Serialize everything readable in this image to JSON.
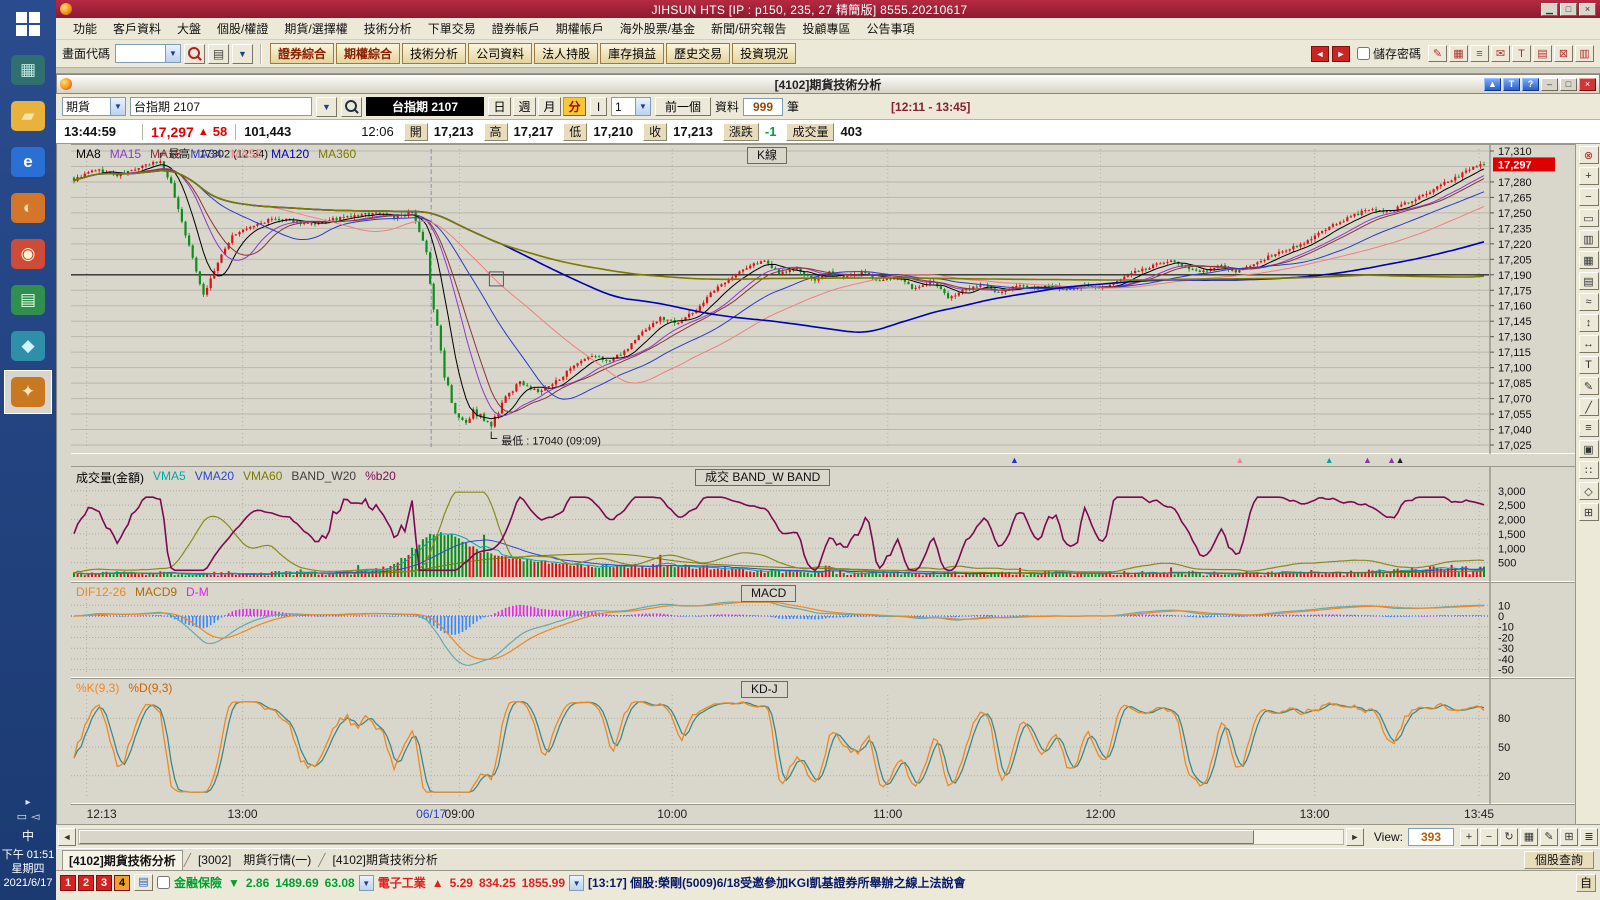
{
  "titlebar": {
    "title": "JIHSUN HTS    [IP : p150, 235, 27 精簡版] 8555.20210617"
  },
  "sidebar": {
    "clock_ampm": "下午 01:51",
    "clock_weekday": "星期四",
    "clock_date": "2021/6/17",
    "lang_indicator": "中",
    "icons": [
      {
        "name": "start-menu",
        "glyph": "",
        "bg": "",
        "fg": ""
      },
      {
        "name": "spreadsheet-app",
        "glyph": "▦",
        "bg": "#2f6f6f",
        "fg": "#bfe8e0"
      },
      {
        "name": "folder",
        "glyph": "▰",
        "bg": "#e8b23c",
        "fg": "#f8e4a8"
      },
      {
        "name": "internet-explorer",
        "glyph": "e",
        "bg": "#2a6fd4",
        "fg": "#ffffff"
      },
      {
        "name": "paint-app",
        "glyph": "◐",
        "bg": "#d4762a",
        "fg": "#ffe2b0"
      },
      {
        "name": "chrome-browser",
        "glyph": "◉",
        "bg": "#ce4b37",
        "fg": "#fdf3d0"
      },
      {
        "name": "document-app",
        "glyph": "▤",
        "bg": "#2f8f4f",
        "fg": "#e0ffe0"
      },
      {
        "name": "cad-app",
        "glyph": "◆",
        "bg": "#2f8fa8",
        "fg": "#d0f4ff"
      },
      {
        "name": "hts-app",
        "glyph": "✦",
        "bg": "#c87820",
        "fg": "#ffe8c0",
        "active": true
      }
    ]
  },
  "menus": [
    "功能",
    "客戶資料",
    "大盤",
    "個股/權證",
    "期貨/選擇權",
    "技術分析",
    "下單交易",
    "證券帳戶",
    "期權帳戶",
    "海外股票/基金",
    "新聞/研究報告",
    "投顧專區",
    "公告事項"
  ],
  "toolbar": {
    "screen_code_label": "畫面代碼",
    "quick_buttons": [
      {
        "label": "證券綜合",
        "accent": true
      },
      {
        "label": "期權綜合",
        "accent": true
      },
      {
        "label": "技術分析",
        "accent": false
      },
      {
        "label": "公司資料",
        "accent": false
      },
      {
        "label": "法人持股",
        "accent": false
      },
      {
        "label": "庫存損益",
        "accent": false
      },
      {
        "label": "歷史交易",
        "accent": false
      },
      {
        "label": "投資現況",
        "accent": false
      }
    ],
    "save_password_label": "儲存密碼",
    "right_icons": [
      "✎",
      "▦",
      "≡",
      "✉",
      "T",
      "▤",
      "⊠",
      "▥"
    ]
  },
  "window": {
    "title": "[4102]期貨技術分析",
    "btn_up": "▲",
    "btn_t": "T",
    "btn_help": "?",
    "btn_min": "–",
    "btn_max": "□",
    "btn_close": "×"
  },
  "controls": {
    "market": "期貨",
    "symbol": "台指期 2107",
    "symbol_display": "台指期 2107",
    "periods": [
      "日",
      "週",
      "月",
      "分"
    ],
    "active_period": "分",
    "i_button": "I",
    "interval": "1",
    "prev_button": "前一個",
    "data_label": "資料",
    "data_count": "999",
    "unit_label": "筆",
    "range_label": "[12:11 - 13:45]"
  },
  "quote": {
    "time": "13:44:59",
    "last": "17,297",
    "dir": "▲",
    "change": "58",
    "total_volume": "101,443",
    "bar_time": "12:06",
    "open_label": "開",
    "open": "17,213",
    "high_label": "高",
    "high": "17,217",
    "low_label": "低",
    "low": "17,210",
    "close_label": "收",
    "close": "17,213",
    "chg_label": "漲跌",
    "chg": "-1",
    "vol_label": "成交量",
    "vol": "403"
  },
  "chart_data": {
    "type": "candlestick",
    "symbol": "台指期 2107",
    "interval": "1分",
    "bars": 393,
    "price_axis": {
      "min": 17025,
      "max": 17310,
      "tick_step": 15
    },
    "current_price": 17297,
    "prev_ref_price": 17190,
    "session_break_frac": 0.254,
    "high_annotation": {
      "text": "最高 : 17302 (12:34)",
      "price": 17302,
      "frac": 0.06
    },
    "low_annotation": {
      "text": "最低 : 17040 (09:09)",
      "price": 17040,
      "frac": 0.296
    },
    "cursor_box": {
      "frac": 0.3,
      "price": 17186
    },
    "x_labels": [
      {
        "label": "12:13",
        "frac": 0.011
      },
      {
        "label": "13:00",
        "frac": 0.121
      },
      {
        "label": "06/17",
        "frac": 0.254,
        "highlight": true
      },
      {
        "label": "09:00",
        "frac": 0.274
      },
      {
        "label": "10:00",
        "frac": 0.424
      },
      {
        "label": "11:00",
        "frac": 0.576
      },
      {
        "label": "12:00",
        "frac": 0.726
      },
      {
        "label": "13:00",
        "frac": 0.877
      },
      {
        "label": "13:45",
        "frac": 0.993
      }
    ],
    "price_anchors": [
      [
        0.0,
        17282
      ],
      [
        0.015,
        17292
      ],
      [
        0.03,
        17286
      ],
      [
        0.045,
        17293
      ],
      [
        0.06,
        17300
      ],
      [
        0.068,
        17282
      ],
      [
        0.08,
        17225
      ],
      [
        0.092,
        17170
      ],
      [
        0.1,
        17196
      ],
      [
        0.112,
        17228
      ],
      [
        0.125,
        17236
      ],
      [
        0.14,
        17244
      ],
      [
        0.155,
        17242
      ],
      [
        0.17,
        17238
      ],
      [
        0.185,
        17244
      ],
      [
        0.2,
        17247
      ],
      [
        0.215,
        17250
      ],
      [
        0.23,
        17246
      ],
      [
        0.242,
        17248
      ],
      [
        0.25,
        17210
      ],
      [
        0.256,
        17150
      ],
      [
        0.262,
        17100
      ],
      [
        0.27,
        17060
      ],
      [
        0.278,
        17050
      ],
      [
        0.285,
        17058
      ],
      [
        0.291,
        17046
      ],
      [
        0.296,
        17042
      ],
      [
        0.302,
        17058
      ],
      [
        0.308,
        17075
      ],
      [
        0.318,
        17086
      ],
      [
        0.328,
        17076
      ],
      [
        0.338,
        17082
      ],
      [
        0.348,
        17094
      ],
      [
        0.358,
        17104
      ],
      [
        0.368,
        17112
      ],
      [
        0.38,
        17106
      ],
      [
        0.392,
        17118
      ],
      [
        0.404,
        17136
      ],
      [
        0.416,
        17148
      ],
      [
        0.428,
        17144
      ],
      [
        0.44,
        17154
      ],
      [
        0.452,
        17172
      ],
      [
        0.464,
        17186
      ],
      [
        0.476,
        17196
      ],
      [
        0.488,
        17204
      ],
      [
        0.5,
        17192
      ],
      [
        0.512,
        17196
      ],
      [
        0.524,
        17184
      ],
      [
        0.536,
        17192
      ],
      [
        0.548,
        17188
      ],
      [
        0.56,
        17192
      ],
      [
        0.572,
        17184
      ],
      [
        0.584,
        17188
      ],
      [
        0.596,
        17176
      ],
      [
        0.608,
        17184
      ],
      [
        0.62,
        17168
      ],
      [
        0.632,
        17176
      ],
      [
        0.644,
        17180
      ],
      [
        0.656,
        17172
      ],
      [
        0.668,
        17180
      ],
      [
        0.68,
        17176
      ],
      [
        0.692,
        17180
      ],
      [
        0.704,
        17176
      ],
      [
        0.716,
        17180
      ],
      [
        0.728,
        17176
      ],
      [
        0.74,
        17184
      ],
      [
        0.752,
        17192
      ],
      [
        0.764,
        17198
      ],
      [
        0.776,
        17204
      ],
      [
        0.788,
        17198
      ],
      [
        0.8,
        17192
      ],
      [
        0.812,
        17200
      ],
      [
        0.824,
        17192
      ],
      [
        0.836,
        17200
      ],
      [
        0.848,
        17208
      ],
      [
        0.86,
        17214
      ],
      [
        0.872,
        17220
      ],
      [
        0.884,
        17232
      ],
      [
        0.896,
        17240
      ],
      [
        0.908,
        17248
      ],
      [
        0.92,
        17254
      ],
      [
        0.932,
        17250
      ],
      [
        0.944,
        17260
      ],
      [
        0.956,
        17266
      ],
      [
        0.968,
        17276
      ],
      [
        0.98,
        17284
      ],
      [
        0.99,
        17292
      ],
      [
        1.0,
        17297
      ]
    ],
    "ma_lines": [
      {
        "label": "MA8",
        "window": 8,
        "color": "#000000"
      },
      {
        "label": "MA15",
        "window": 15,
        "color": "#8a3cc8"
      },
      {
        "label": "MA18",
        "window": 18,
        "color": "#8a3434"
      },
      {
        "label": "MA34",
        "window": 34,
        "color": "#2a3cc8"
      },
      {
        "label": "MA55",
        "window": 55,
        "color": "#ee8080"
      },
      {
        "label": "MA120",
        "window": 120,
        "color": "#0000b4"
      },
      {
        "label": "MA360",
        "window": 360,
        "color": "#7a7a00"
      }
    ],
    "kline_box_label": "K線",
    "volume_panel": {
      "legend": [
        {
          "t": "成交量(金額)",
          "c": "#000000"
        },
        {
          "t": "VMA5",
          "c": "#00a8a8"
        },
        {
          "t": "VMA20",
          "c": "#2a46d4"
        },
        {
          "t": "VMA60",
          "c": "#7a7a00"
        },
        {
          "t": "BAND_W20",
          "c": "#404040"
        },
        {
          "t": "%b20",
          "c": "#7c0a50"
        }
      ],
      "box_label": "成交  BAND_W  BAND",
      "ticks": [
        500,
        1000,
        1500,
        2000,
        2500,
        3000
      ],
      "max": 3200
    },
    "macd_panel": {
      "legend": [
        {
          "t": "DIF12-26",
          "c": "#ee8822"
        },
        {
          "t": "MACD9",
          "c": "#b46a00"
        },
        {
          "t": "D-M",
          "c": "#e822e8"
        }
      ],
      "box_label": "MACD",
      "ticks": [
        10,
        0,
        -10,
        -20,
        -30,
        -40,
        -50
      ]
    },
    "kd_panel": {
      "legend": [
        {
          "t": "%K(9,3)",
          "c": "#ee8822"
        },
        {
          "t": "%D(9,3)",
          "c": "#c86400"
        }
      ],
      "box_label": "KD-J",
      "ticks": [
        80,
        50,
        20
      ]
    },
    "signal_markers": [
      {
        "frac": 0.665,
        "color": "#2233cc"
      },
      {
        "frac": 0.824,
        "color": "#ee82a0"
      },
      {
        "frac": 0.887,
        "color": "#00a8a8"
      },
      {
        "frac": 0.914,
        "color": "#8833aa"
      },
      {
        "frac": 0.931,
        "color": "#8833aa"
      },
      {
        "frac": 0.937,
        "color": "#202020"
      }
    ],
    "tool_icons": [
      "⊗",
      "+",
      "−",
      "▭",
      "▥",
      "▦",
      "▤",
      "≈",
      "↕",
      "↔",
      "T",
      "✎",
      "╱",
      "≡",
      "▣",
      "∷",
      "◇",
      "⊞"
    ]
  },
  "scrollbar": {
    "left_arrow": "◄",
    "right_arrow": "►",
    "view_label": "View:",
    "view_value": "393",
    "icons": [
      "+",
      "−",
      "↻",
      "▦",
      "✎",
      "⊞",
      "≣"
    ]
  },
  "tabs": {
    "items": [
      "[4102]期貨技術分析",
      "[3002]　期貨行情(一)",
      "[4102]期貨技術分析"
    ],
    "right_button": "個股查詢"
  },
  "statusbar": {
    "page_tabs": [
      {
        "label": "1",
        "bg": "#d42222",
        "fg": "#ffffff"
      },
      {
        "label": "2",
        "bg": "#d42222",
        "fg": "#ffffff"
      },
      {
        "label": "3",
        "bg": "#d42222",
        "fg": "#ffffff"
      },
      {
        "label": "4",
        "bg": "#f0a030",
        "fg": "#000000"
      }
    ],
    "ticker1": {
      "name": "金融保險",
      "dir": "▼",
      "v1": "2.86",
      "v2": "1489.69",
      "v3": "63.08",
      "color": "#00a030"
    },
    "ticker2": {
      "name": "電子工業",
      "dir": "▲",
      "v1": "5.29",
      "v2": "834.25",
      "v3": "1855.99",
      "color": "#e02020"
    },
    "news": "[13:17] 個股:榮剛(5009)6/18受邀參加KGI凱基證券所舉辦之線上法說會",
    "right_button": "自"
  }
}
